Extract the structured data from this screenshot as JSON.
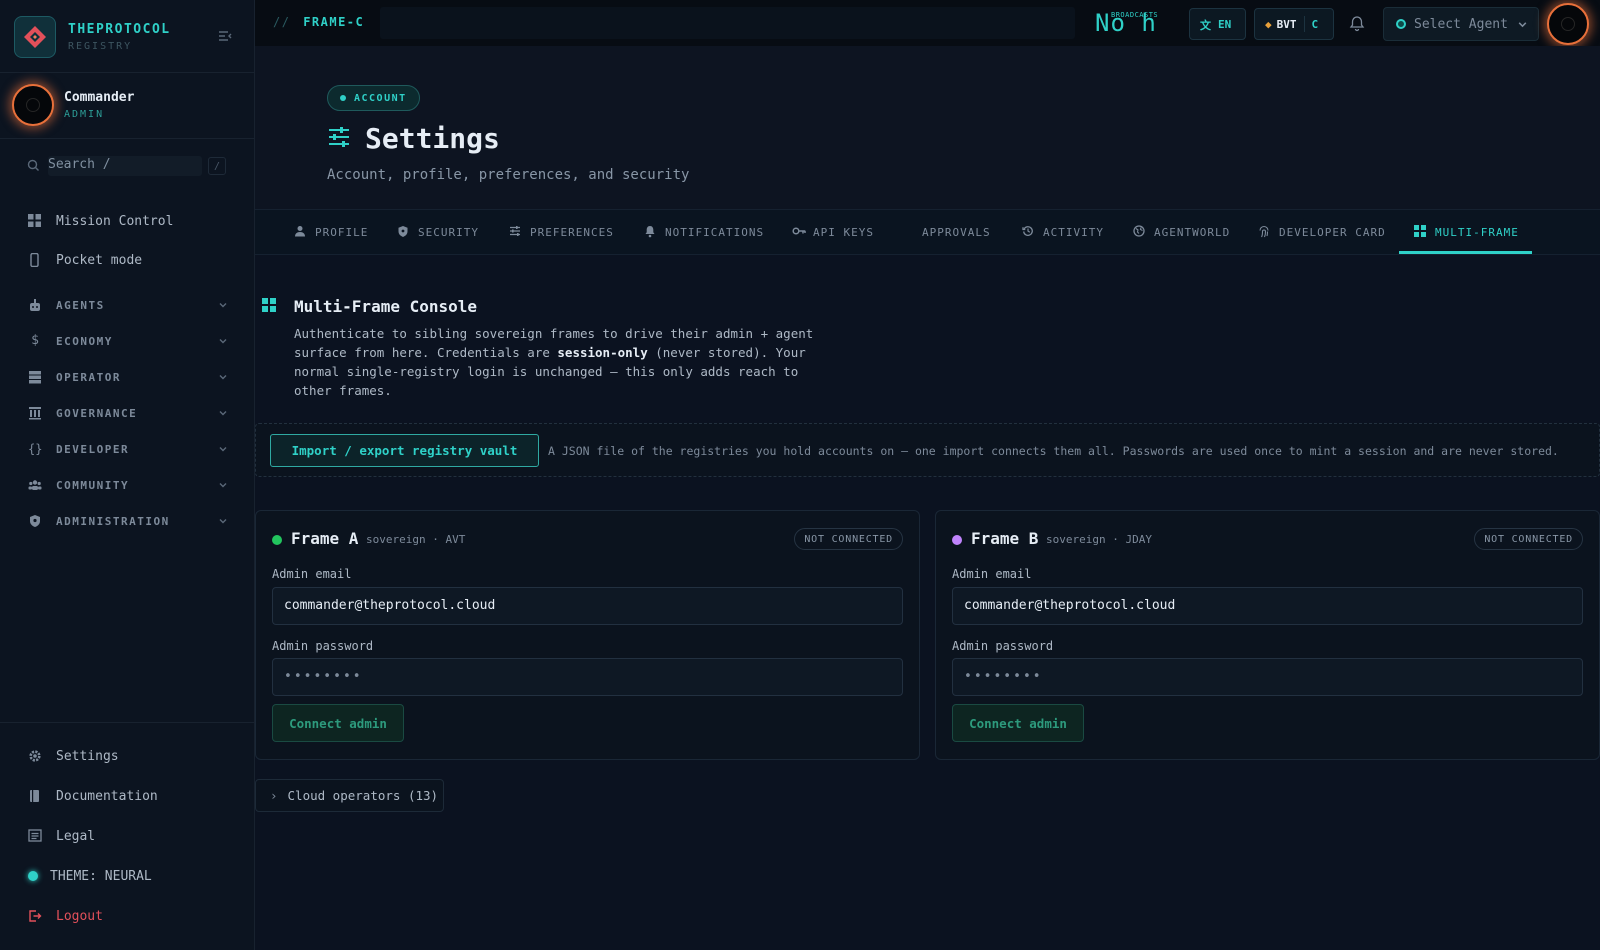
{
  "brand": {
    "title": "THEPROTOCOL",
    "subtitle": "REGISTRY"
  },
  "user": {
    "name": "Commander",
    "role": "ADMIN"
  },
  "search": {
    "placeholder": "Search  /",
    "shortcut": "/"
  },
  "sidebar": {
    "primary": [
      {
        "label": "Mission Control",
        "icon": "grid-icon"
      },
      {
        "label": "Pocket mode",
        "icon": "phone-icon"
      }
    ],
    "groups": [
      {
        "label": "AGENTS",
        "icon": "robot-icon"
      },
      {
        "label": "ECONOMY",
        "icon": "dollar-icon"
      },
      {
        "label": "OPERATOR",
        "icon": "server-icon"
      },
      {
        "label": "GOVERNANCE",
        "icon": "building-icon"
      },
      {
        "label": "DEVELOPER",
        "icon": "braces-icon"
      },
      {
        "label": "COMMUNITY",
        "icon": "people-icon"
      },
      {
        "label": "ADMINISTRATION",
        "icon": "shield-icon"
      }
    ],
    "footer": [
      {
        "label": "Settings",
        "icon": "gear-icon"
      },
      {
        "label": "Documentation",
        "icon": "book-icon"
      },
      {
        "label": "Legal",
        "icon": "document-icon"
      }
    ],
    "theme": "THEME: NEURAL",
    "logout": "Logout"
  },
  "topbar": {
    "breadcrumb_slash": "//",
    "breadcrumb": "FRAME-C",
    "clock": "No h",
    "clock_tag": "BROADCASTS",
    "lang": "EN",
    "token": "BVT",
    "token_suffix": "C",
    "agent_select": "Select Agent"
  },
  "header": {
    "badge": "ACCOUNT",
    "title": "Settings",
    "subtitle": "Account, profile, preferences, and security"
  },
  "tabs": [
    {
      "label": "PROFILE",
      "icon": "person-icon"
    },
    {
      "label": "SECURITY",
      "icon": "shield-icon"
    },
    {
      "label": "PREFERENCES",
      "icon": "sliders-icon"
    },
    {
      "label": "NOTIFICATIONS",
      "icon": "bell-icon"
    },
    {
      "label": "API KEYS",
      "icon": "key-icon"
    },
    {
      "label": "APPROVALS",
      "icon": ""
    },
    {
      "label": "ACTIVITY",
      "icon": "history-icon"
    },
    {
      "label": "AGENTWORLD",
      "icon": "globe-icon"
    },
    {
      "label": "DEVELOPER CARD",
      "icon": "fingerprint-icon"
    },
    {
      "label": "MULTI-FRAME",
      "icon": "grid-icon",
      "active": true
    }
  ],
  "section": {
    "title": "Multi-Frame Console",
    "desc_pre": "Authenticate to sibling sovereign frames to drive their admin + agent surface from here. Credentials are ",
    "desc_bold": "session-only",
    "desc_post": " (never stored). Your normal single-registry login is unchanged — this only adds reach to other frames."
  },
  "vault": {
    "button": "Import / export registry vault",
    "note": "A JSON file of the registries you hold accounts on — one import connects them all. Passwords are used once to mint a session and are never stored."
  },
  "frames": [
    {
      "name": "Frame A",
      "meta": "sovereign · AVT",
      "status": "NOT CONNECTED",
      "dot_color": "#22c55e",
      "email_label": "Admin email",
      "email": "commander@theprotocol.cloud",
      "password_label": "Admin password",
      "password_mask": "••••••••",
      "button": "Connect admin"
    },
    {
      "name": "Frame B",
      "meta": "sovereign · JDAY",
      "status": "NOT CONNECTED",
      "dot_color": "#c084fc",
      "email_label": "Admin email",
      "email": "commander@theprotocol.cloud",
      "password_label": "Admin password",
      "password_mask": "••••••••",
      "button": "Connect admin"
    }
  ],
  "cloud_operators": {
    "chevron": "›",
    "label": "Cloud operators (13)"
  },
  "colors": {
    "accent": "#2fd1c8",
    "danger": "#e2505a",
    "avatar_ring": "#e8703a",
    "background": "#0a1019"
  }
}
